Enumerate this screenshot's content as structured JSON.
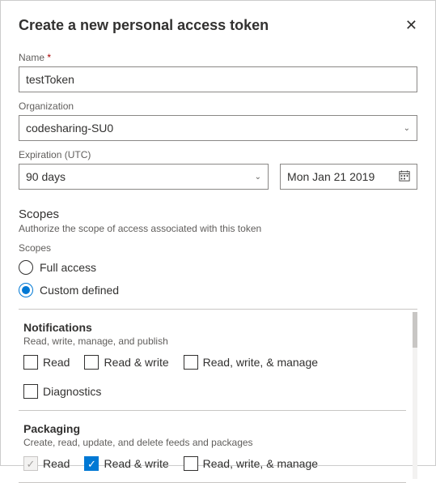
{
  "header": {
    "title": "Create a new personal access token"
  },
  "fields": {
    "name": {
      "label": "Name",
      "value": "testToken"
    },
    "organization": {
      "label": "Organization",
      "value": "codesharing-SU0"
    },
    "expiration": {
      "label": "Expiration (UTC)",
      "duration": "90 days",
      "date": "Mon Jan 21 2019"
    }
  },
  "scopes": {
    "title": "Scopes",
    "subtitle": "Authorize the scope of access associated with this token",
    "label": "Scopes",
    "options": {
      "full": "Full access",
      "custom": "Custom defined"
    }
  },
  "scopeGroups": {
    "notifications": {
      "name": "Notifications",
      "desc": "Read, write, manage, and publish",
      "items": {
        "read": "Read",
        "rw": "Read & write",
        "rwm": "Read, write, & manage",
        "diag": "Diagnostics"
      }
    },
    "packaging": {
      "name": "Packaging",
      "desc": "Create, read, update, and delete feeds and packages",
      "items": {
        "read": "Read",
        "rw": "Read & write",
        "rwm": "Read, write, & manage"
      }
    }
  }
}
